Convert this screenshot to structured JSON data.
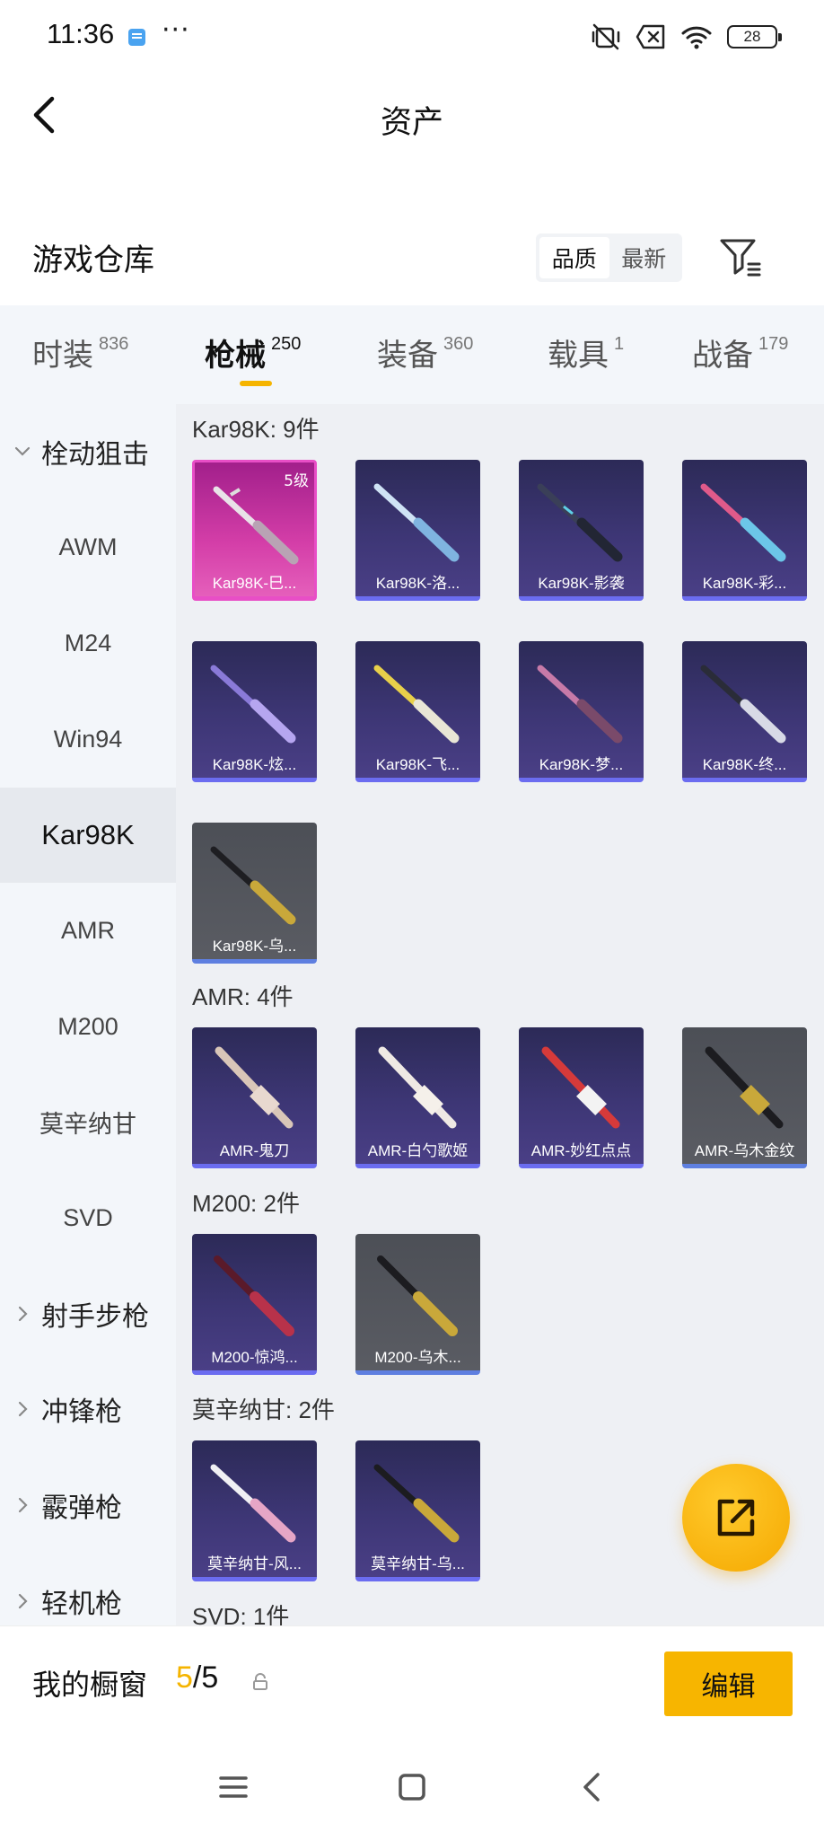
{
  "status": {
    "time": "11:36",
    "more": "···",
    "battery": "28"
  },
  "header": {
    "title": "资产"
  },
  "warehouse": {
    "title": "游戏仓库",
    "sort_quality": "品质",
    "sort_newest": "最新"
  },
  "tabs": [
    {
      "label": "时装",
      "count": "836"
    },
    {
      "label": "枪械",
      "count": "250"
    },
    {
      "label": "装备",
      "count": "360"
    },
    {
      "label": "载具",
      "count": "1"
    },
    {
      "label": "战备",
      "count": "179"
    }
  ],
  "sidebar": {
    "group_bolt": "栓动狙击",
    "items": [
      "AWM",
      "M24",
      "Win94",
      "Kar98K",
      "AMR",
      "M200",
      "莫辛纳甘",
      "SVD"
    ],
    "groups": [
      "射手步枪",
      "冲锋枪",
      "霰弹枪",
      "轻机枪"
    ]
  },
  "groups": [
    {
      "title": "Kar98K: 9件",
      "items": [
        {
          "name": "Kar98K-巳...",
          "level": "5级"
        },
        {
          "name": "Kar98K-洛..."
        },
        {
          "name": "Kar98K-影袭"
        },
        {
          "name": "Kar98K-彩..."
        },
        {
          "name": "Kar98K-炫..."
        },
        {
          "name": "Kar98K-飞..."
        },
        {
          "name": "Kar98K-梦..."
        },
        {
          "name": "Kar98K-终..."
        },
        {
          "name": "Kar98K-乌..."
        }
      ]
    },
    {
      "title": "AMR: 4件",
      "items": [
        {
          "name": "AMR-鬼刀"
        },
        {
          "name": "AMR-白勺歌姬"
        },
        {
          "name": "AMR-妙红点点"
        },
        {
          "name": "AMR-乌木金纹"
        }
      ]
    },
    {
      "title": "M200: 2件",
      "items": [
        {
          "name": "M200-惊鸿..."
        },
        {
          "name": "M200-乌木..."
        }
      ]
    },
    {
      "title": "莫辛纳甘: 2件",
      "items": [
        {
          "name": "莫辛纳甘-风..."
        },
        {
          "name": "莫辛纳甘-乌..."
        }
      ]
    },
    {
      "title": "SVD: 1件"
    }
  ],
  "showcase": {
    "label": "我的橱窗",
    "current": "5",
    "total": "/5",
    "edit_label": "编辑"
  }
}
